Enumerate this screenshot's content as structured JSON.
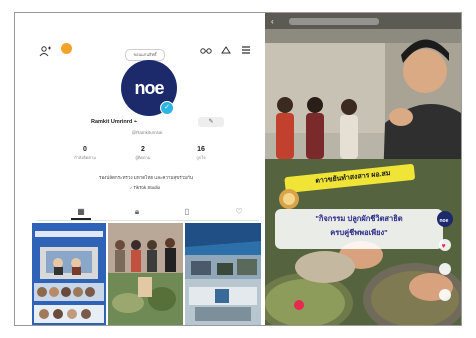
{
  "profile": {
    "name_pill": "ขอนแก่นสิทธิ์",
    "avatar_text": "noe",
    "display_name": "Ramkit Umrinrd ⌁",
    "handle": "@Ramkiturnsai",
    "edit_label": "✎",
    "stats": [
      {
        "value": "0",
        "label": "กำลังติดตาม"
      },
      {
        "value": "2",
        "label": "ผู้ติดตาม"
      },
      {
        "value": "16",
        "label": "ถูกใจ"
      }
    ],
    "bio": "รองปลัดกระทรวง มหาดไทย และความสุขร่วมกัน",
    "studio_label": "TikTok Studio"
  },
  "video": {
    "banner": "ดาวขยันทำสงสาร ผอ.สม",
    "caption_line1": "\"กิจกรรม ปลูกผักชีวิตสาธิต",
    "caption_line2": "ครบคู่ชีพพอเพียง\"",
    "brand_chip": "noe"
  },
  "colors": {
    "brand_navy": "#1c2a6b",
    "badge_blue": "#2bb5e3",
    "coin_orange": "#f3a32a",
    "tiktok_red": "#e5294f",
    "banner_yellow": "#f0e436"
  }
}
